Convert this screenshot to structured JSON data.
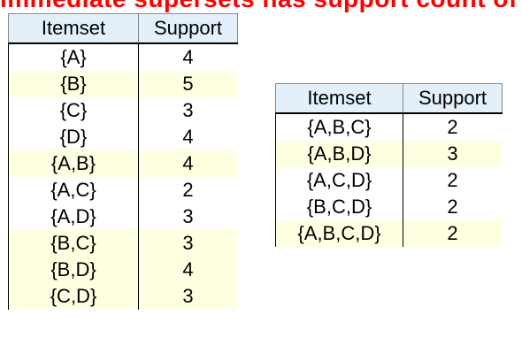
{
  "heading": {
    "text": "immediate supersets has support count of",
    "color": "#ff0000"
  },
  "row_colors": {
    "header": "#e3f0fa",
    "light": "#ffffff",
    "highlight": "#ffffe1"
  },
  "left_table": {
    "headers": [
      "Itemset",
      "Support"
    ],
    "rows": [
      {
        "itemset": "{A}",
        "support": "4",
        "shade": "light"
      },
      {
        "itemset": "{B}",
        "support": "5",
        "shade": "highlight"
      },
      {
        "itemset": "{C}",
        "support": "3",
        "shade": "light"
      },
      {
        "itemset": "{D}",
        "support": "4",
        "shade": "light"
      },
      {
        "itemset": "{A,B}",
        "support": "4",
        "shade": "highlight"
      },
      {
        "itemset": "{A,C}",
        "support": "2",
        "shade": "light"
      },
      {
        "itemset": "{A,D}",
        "support": "3",
        "shade": "light"
      },
      {
        "itemset": "{B,C}",
        "support": "3",
        "shade": "highlight"
      },
      {
        "itemset": "{B,D}",
        "support": "4",
        "shade": "highlight"
      },
      {
        "itemset": "{C,D}",
        "support": "3",
        "shade": "highlight"
      }
    ]
  },
  "right_table": {
    "headers": [
      "Itemset",
      "Support"
    ],
    "rows": [
      {
        "itemset": "{A,B,C}",
        "support": "2",
        "shade": "light"
      },
      {
        "itemset": "{A,B,D}",
        "support": "3",
        "shade": "highlight"
      },
      {
        "itemset": "{A,C,D}",
        "support": "2",
        "shade": "light"
      },
      {
        "itemset": "{B,C,D}",
        "support": "2",
        "shade": "light"
      },
      {
        "itemset": "{A,B,C,D}",
        "support": "2",
        "shade": "highlight"
      }
    ]
  }
}
